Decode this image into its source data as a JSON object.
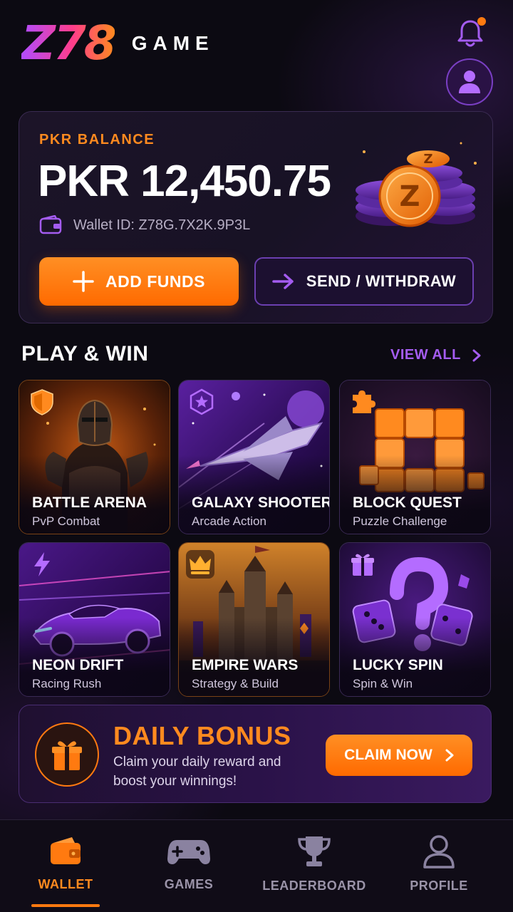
{
  "header": {
    "logo_mark": "Z78",
    "logo_word": "GAME",
    "bell_icon": "bell-icon",
    "avatar_icon": "user-icon"
  },
  "balance": {
    "label": "PKR BALANCE",
    "amount": "PKR 12,450.75",
    "wallet_id": "Wallet ID: Z78G.7X2K.9P3L",
    "add_funds_label": "ADD FUNDS",
    "send_withdraw_label": "SEND / WITHDRAW"
  },
  "section": {
    "title": "PLAY & WIN",
    "view_all_label": "VIEW ALL"
  },
  "games": [
    {
      "title": "BATTLE ARENA",
      "subtitle": "PvP Combat",
      "badge": "shield-icon"
    },
    {
      "title": "GALAXY SHOOTERS",
      "subtitle": "Arcade Action",
      "badge": "star-hexagon-icon"
    },
    {
      "title": "BLOCK QUEST",
      "subtitle": "Puzzle Challenge",
      "badge": "puzzle-icon"
    },
    {
      "title": "NEON DRIFT",
      "subtitle": "Racing Rush",
      "badge": "lightning-icon"
    },
    {
      "title": "EMPIRE WARS",
      "subtitle": "Strategy & Build",
      "badge": "crown-icon"
    },
    {
      "title": "LUCKY SPIN",
      "subtitle": "Spin & Win",
      "badge": "gift-icon"
    }
  ],
  "bonus": {
    "title": "DAILY BONUS",
    "description": "Claim your daily reward and boost your winnings!",
    "claim_label": "CLAIM NOW"
  },
  "nav": {
    "items": [
      {
        "label": "WALLET",
        "icon": "wallet-icon",
        "active": true
      },
      {
        "label": "GAMES",
        "icon": "gamepad-icon",
        "active": false
      },
      {
        "label": "LEADERBOARD",
        "icon": "trophy-icon",
        "active": false
      },
      {
        "label": "PROFILE",
        "icon": "user-icon",
        "active": false
      }
    ]
  },
  "colors": {
    "accent_orange": "#ff7a10",
    "accent_purple": "#a45cf0",
    "background": "#0c0a12"
  }
}
